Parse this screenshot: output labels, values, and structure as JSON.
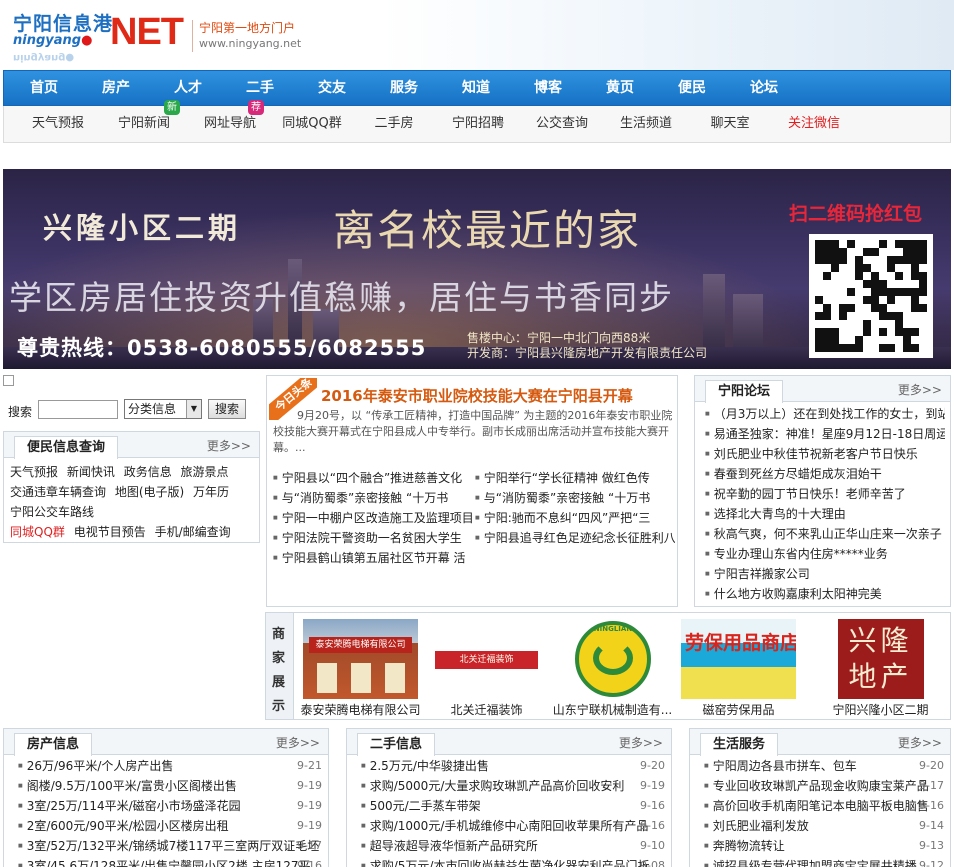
{
  "header": {
    "logo_cn": "宁阳信息港",
    "logo_py": "ningyang",
    "logo_net": "NET",
    "slogan": "宁阳第一地方门户",
    "url": "www.ningyang.net"
  },
  "main_nav": [
    "首页",
    "房产",
    "人才",
    "二手",
    "交友",
    "服务",
    "知道",
    "博客",
    "黄页",
    "便民",
    "论坛"
  ],
  "sub_nav": [
    {
      "label": "天气预报"
    },
    {
      "label": "宁阳新闻",
      "badge": "新"
    },
    {
      "label": "网址导航",
      "badge": "荐"
    },
    {
      "label": "同城QQ群"
    },
    {
      "label": "二手房"
    },
    {
      "label": "宁阳招聘"
    },
    {
      "label": "公交查询"
    },
    {
      "label": "生活频道"
    },
    {
      "label": "聊天室"
    },
    {
      "label": "关注微信"
    }
  ],
  "banner": {
    "title_left": "兴隆小区二期",
    "title_mid": "离名校最近的家",
    "scan_text": "扫二维码抢红包",
    "headline": "学区房居住投资升值稳赚，居住与书香同步",
    "hotline": "尊贵热线：0538-6080555/6082555",
    "sales_center": "售楼中心：宁阳一中北门向西88米",
    "developer": "开发商：宁阳县兴隆房地产开发有限责任公司"
  },
  "search": {
    "label": "搜索",
    "select_value": "分类信息",
    "button": "搜索"
  },
  "bianmin": {
    "title": "便民信息查询",
    "more": "更多>>",
    "rows": [
      [
        "天气预报",
        "新闻快讯",
        "政务信息",
        "旅游景点"
      ],
      [
        "交通违章车辆查询",
        "地图(电子版)",
        "万年历"
      ],
      [
        "宁阳公交车路线"
      ],
      [
        "同城QQ群",
        "电视节目预告",
        "手机/邮编查询"
      ]
    ]
  },
  "news": {
    "tag": "今日头条",
    "title": "2016年泰安市职业院校技能大赛在宁阳县开幕",
    "summary": "9月20号，以 “传承工匠精神，打造中国品牌” 为主题的2016年泰安市职业院校技能大赛开幕式在宁阳县成人中专举行。副市长成丽出席活动并宣布技能大赛开幕。...",
    "items": [
      "宁阳县以“四个融合”推进慈善文化",
      "宁阳举行“学长征精神 做红色传",
      "与“消防蜀黍”亲密接触 “十万书",
      "与“消防蜀黍”亲密接触 “十万书",
      "宁阳一中棚户区改造施工及监理项目",
      "宁阳:驰而不息纠“四风”严把“三",
      "宁阳法院干警资助一名贫困大学生",
      "宁阳县追寻红色足迹纪念长征胜利八",
      "宁阳县鹤山镇第五届社区节开幕 活"
    ]
  },
  "forum": {
    "title": "宁阳论坛",
    "more": "更多>>",
    "items": [
      "（月3万以上）还在到处找工作的女士，到站",
      "易通圣独家：神准！星座9月12日-18日周运势",
      "刘氏肥业中秋佳节祝新老客户节日快乐",
      "春蚕到死丝方尽蜡炬成灰泪始干",
      "祝辛勤的园丁节日快乐！老师辛苦了",
      "选择北大青鸟的十大理由",
      "秋高气爽，何不来乳山正华山庄来一次亲子",
      "专业办理山东省内住房*****业务",
      "宁阳吉祥搬家公司",
      "什么地方收购嘉康利太阳神完美"
    ]
  },
  "merchants": {
    "side": [
      "商",
      "家",
      "展",
      "示"
    ],
    "items": [
      {
        "name": "泰安荣腾电梯有限公司",
        "sign": "泰安荣腾电梯有限公司"
      },
      {
        "name": "北关迁福装饰",
        "sign": "北关迁福装饰"
      },
      {
        "name": "山东宁联机械制造有...",
        "sign": "NINGLIAN"
      },
      {
        "name": "磁窑劳保用品",
        "sign": "劳保用品商店"
      },
      {
        "name": "宁阳兴隆小区二期",
        "sign": "兴隆地产"
      }
    ]
  },
  "columns": [
    {
      "title": "房产信息",
      "more": "更多>>",
      "items": [
        {
          "text": "26万/96平米/个人房产出售",
          "date": "9-21"
        },
        {
          "text": "阁楼/9.5万/100平米/富贵小区阁楼出售",
          "date": "9-19"
        },
        {
          "text": "3室/25万/114平米/磁窑小市场盛泽花园",
          "date": "9-19"
        },
        {
          "text": "2室/600元/90平米/松园小区楼房出租",
          "date": "9-19"
        },
        {
          "text": "3室/52万/132平米/锦绣城7楼117平三室两厅双证毛坯",
          "date": "9-17"
        },
        {
          "text": "3室/45.6万/128平米/出售宁馨园小区2楼 主房127平",
          "date": "9-16"
        }
      ]
    },
    {
      "title": "二手信息",
      "more": "更多>>",
      "items": [
        {
          "text": "2.5万元/中华骏捷出售",
          "date": "9-20"
        },
        {
          "text": "求购/5000元/大量求购玫琳凯产品高价回收安利",
          "date": "9-19"
        },
        {
          "text": "500元/二手蒸车带架",
          "date": "9-16"
        },
        {
          "text": "求购/1000元/手机城维修中心南阳回收苹果所有产品",
          "date": "9-16"
        },
        {
          "text": "超导液超导液华恒新产品研究所",
          "date": "9-10"
        },
        {
          "text": "求购/5万元/本市回收尚赫益生菌净化器安利产品门折",
          "date": "9-08"
        }
      ]
    },
    {
      "title": "生活服务",
      "more": "更多>>",
      "items": [
        {
          "text": "宁阳周边各县市拼车、包车",
          "date": "9-20"
        },
        {
          "text": "专业回收玫琳凯产品现金收购康宝莱产品",
          "date": "9-17"
        },
        {
          "text": "高价回收手机南阳笔记本电脑平板电脑售",
          "date": "9-16"
        },
        {
          "text": "刘氏肥业福利发放",
          "date": "9-14"
        },
        {
          "text": "奔腾物流转让",
          "date": "9-13"
        },
        {
          "text": "诚招县级专营代理加盟商宝宝展共精播",
          "date": "9-12"
        }
      ]
    }
  ]
}
